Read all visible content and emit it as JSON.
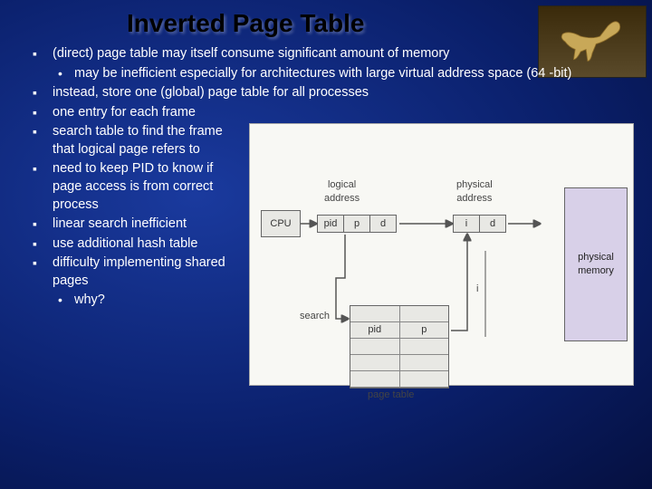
{
  "title": "Inverted Page Table",
  "bullets": {
    "b1": "(direct) page table may itself consume significant amount of memory",
    "b1s1": "may be inefficient especially for architectures with large virtual address space (64 -bit)",
    "b2": "instead, store one (global) page table for all processes",
    "b3": "one entry for each frame",
    "b4": "search table to find the frame that logical page refers to",
    "b5": "need to keep PID to know if page access is from correct process",
    "b6": "linear search inefficient",
    "b7": "use additional hash table",
    "b8": "difficulty implementing shared pages",
    "b8s1": "why?"
  },
  "diagram": {
    "cpu": "CPU",
    "logical": "logical\naddress",
    "physical": "physical\naddress",
    "physmem": "physical\nmemory",
    "search": "search",
    "pid": "pid",
    "p": "p",
    "d": "d",
    "i": "i",
    "pagetable": "page table"
  }
}
